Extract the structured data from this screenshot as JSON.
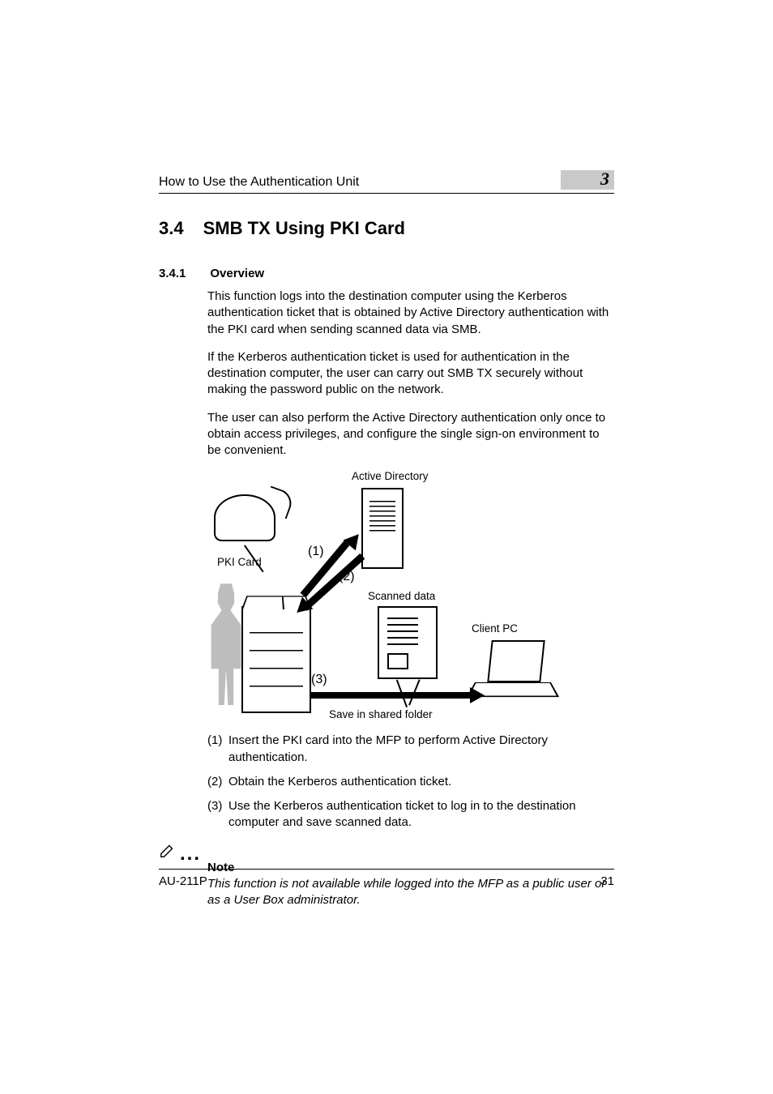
{
  "header": {
    "running_title": "How to Use the Authentication Unit",
    "chapter_number": "3"
  },
  "section": {
    "number": "3.4",
    "title": "SMB TX Using PKI Card"
  },
  "subsection": {
    "number": "3.4.1",
    "title": "Overview"
  },
  "paragraphs": {
    "p1": "This function logs into the destination computer using the Kerberos authentication ticket that is obtained by Active Directory authentication with the PKI card when sending scanned data via SMB.",
    "p2": "If the Kerberos authentication ticket is used for authentication in the destination computer, the user can carry out SMB TX securely without making the password public on the network.",
    "p3": "The user can also perform the Active Directory authentication only once to obtain access privileges, and configure the single sign-on environment to be convenient."
  },
  "diagram_labels": {
    "active_directory": "Active Directory",
    "pki_card": "PKI Card",
    "scanned_data": "Scanned data",
    "client_pc": "Client PC",
    "save_caption": "Save in shared folder",
    "arrow1": "(1)",
    "arrow2": "(2)",
    "arrow3": "(3)"
  },
  "steps": [
    {
      "num": "(1)",
      "text": "Insert the PKI card into the MFP to perform Active Directory authentication."
    },
    {
      "num": "(2)",
      "text": "Obtain the Kerberos authentication ticket."
    },
    {
      "num": "(3)",
      "text": "Use the Kerberos authentication ticket to log in to the destination computer and save scanned data."
    }
  ],
  "note": {
    "label": "Note",
    "text": "This function is not available while logged into the MFP as a public user or as a User Box administrator."
  },
  "footer": {
    "model": "AU-211P",
    "page_number": "31"
  }
}
